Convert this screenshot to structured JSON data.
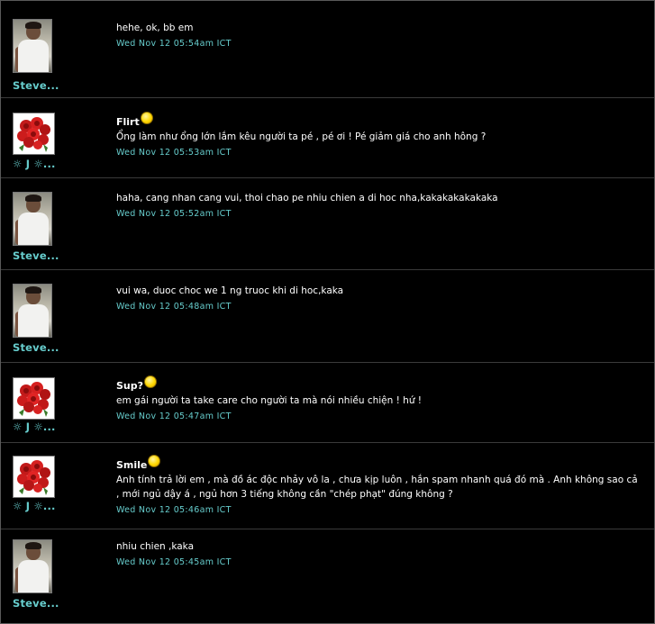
{
  "colors": {
    "background": "#000000",
    "accent": "#66cccc",
    "text": "#ffffff"
  },
  "comments": [
    {
      "user": "Steve...",
      "mood": "",
      "text": "hehe, ok, bb em",
      "timestamp": "Wed Nov 12 05:54am ICT"
    },
    {
      "user": "☼ J ☼...",
      "mood": "Flirt",
      "text": "Ổng làm như ổng lớn lắm kêu người ta pé , pé ơi ! Pé giảm giá cho anh hông ?",
      "timestamp": "Wed Nov 12 05:53am ICT"
    },
    {
      "user": "Steve...",
      "mood": "",
      "text": "haha, cang nhan cang vui, thoi chao pe nhiu chien a di hoc nha,kakakakakakaka",
      "timestamp": "Wed Nov 12 05:52am ICT"
    },
    {
      "user": "Steve...",
      "mood": "",
      "text": "vui wa, duoc choc we 1 ng truoc khi di hoc,kaka",
      "timestamp": "Wed Nov 12 05:48am ICT"
    },
    {
      "user": "☼ J ☼...",
      "mood": "Sup?",
      "text": "em gái người ta take care cho người ta mà nói nhiều chiện ! hứ !",
      "timestamp": "Wed Nov 12 05:47am ICT"
    },
    {
      "user": "☼ J ☼...",
      "mood": "Smile",
      "text": "Anh tính trả lời em , mà đồ ác độc nhảy vô la , chưa kịp luôn , hắn spam nhanh quá đó mà . Anh không sao cả , mới ngủ dậy á , ngủ hơn 3 tiếng không cần \"chép phạt\" đúng không ?",
      "timestamp": "Wed Nov 12 05:46am ICT"
    },
    {
      "user": "Steve...",
      "mood": "",
      "text": "nhiu chien ,kaka",
      "timestamp": "Wed Nov 12 05:45am ICT"
    }
  ]
}
